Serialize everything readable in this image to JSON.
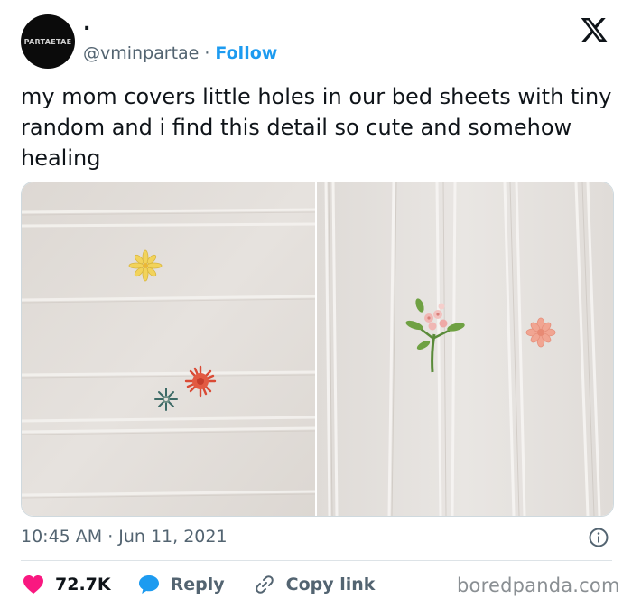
{
  "author": {
    "avatar_text": "PARTAETAE",
    "display_name": ".",
    "handle": "@vminpartae",
    "separator": "·",
    "follow_label": "Follow"
  },
  "brand_icon": "x-logo-icon",
  "tweet": {
    "text": "my mom covers little holes in our bed sheets with tiny random and i find this detail so cute and somehow healing"
  },
  "media": {
    "photos": [
      {
        "name": "bedsheet-embroidery-left",
        "icons": [
          "yellow-flower",
          "red-flower",
          "green-flower"
        ]
      },
      {
        "name": "bedsheet-embroidery-right",
        "icons": [
          "flower-bouquet",
          "pink-flower"
        ]
      }
    ]
  },
  "meta": {
    "time": "10:45 AM",
    "separator": "·",
    "date": "Jun 11, 2021",
    "info_icon": "info-icon"
  },
  "actions": {
    "likes": "72.7K",
    "reply_label": "Reply",
    "copy_link_label": "Copy link"
  },
  "watermark": "boredpanda.com",
  "colors": {
    "accent": "#1d9bf0",
    "like": "#f91880",
    "text": "#0f1419",
    "muted": "#536471",
    "sheet": "#e3dfdb"
  }
}
